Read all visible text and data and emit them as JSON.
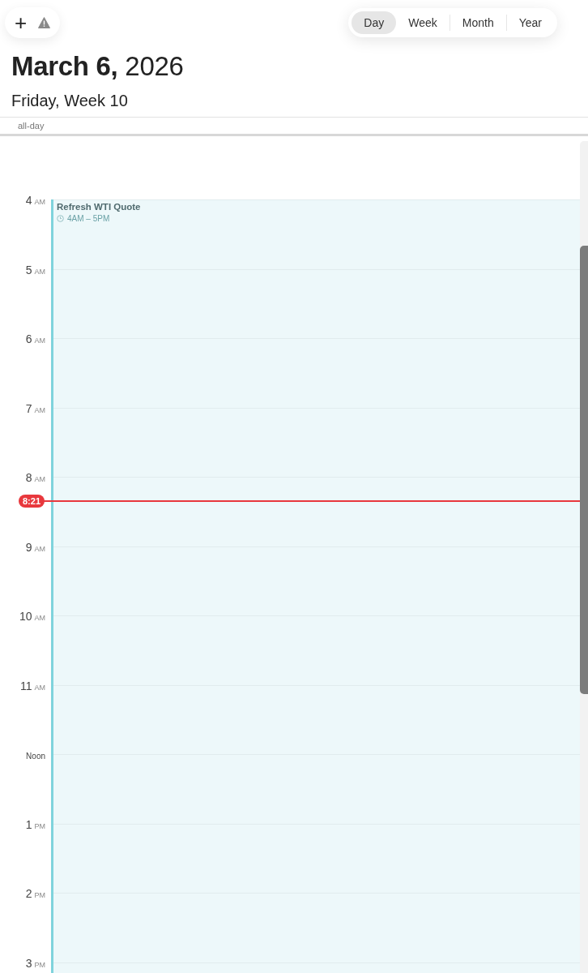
{
  "toolbar": {
    "add": "+"
  },
  "view_tabs": [
    {
      "label": "Day",
      "selected": true
    },
    {
      "label": "Week",
      "selected": false
    },
    {
      "label": "Month",
      "selected": false
    },
    {
      "label": "Year",
      "selected": false
    }
  ],
  "title": "**March 6,** 2026",
  "subtitle": "Friday, Week 10",
  "all_day_label": "all-day",
  "hours": [
    {
      "hour": "4",
      "period": "AM"
    },
    {
      "hour": "5",
      "period": "AM"
    },
    {
      "hour": "6",
      "period": "AM"
    },
    {
      "hour": "7",
      "period": "AM"
    },
    {
      "hour": "8",
      "period": "AM"
    },
    {
      "hour": "9",
      "period": "AM"
    },
    {
      "hour": "10",
      "period": "AM"
    },
    {
      "hour": "11",
      "period": "AM"
    },
    {
      "hour": "Noon"
    },
    {
      "hour": "1",
      "period": "PM"
    },
    {
      "hour": "2",
      "period": "PM"
    },
    {
      "hour": "3",
      "period": "PM"
    }
  ],
  "event": {
    "title": "Refresh WTI Quote",
    "time": "4AM – 5PM",
    "color": "#7fd3dc"
  },
  "now": {
    "time": "8:21"
  }
}
